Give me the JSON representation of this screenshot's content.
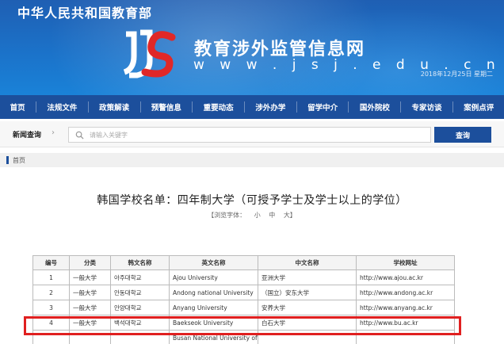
{
  "header": {
    "ministry": "中华人民共和国教育部",
    "site_title": "教育涉外监管信息网",
    "site_url": "w w w . j s j . e d u . c n",
    "date": "2018年12月25日 星期二"
  },
  "nav": {
    "items": [
      {
        "label": "首页"
      },
      {
        "label": "法规文件"
      },
      {
        "label": "政策解读"
      },
      {
        "label": "预警信息"
      },
      {
        "label": "重要动态"
      },
      {
        "label": "涉外办学"
      },
      {
        "label": "留学中介"
      },
      {
        "label": "国外院校"
      },
      {
        "label": "专家访谈"
      },
      {
        "label": "案例点评"
      }
    ]
  },
  "search": {
    "section_label": "新闻查询",
    "placeholder": "请输入关键字",
    "button_label": "查询"
  },
  "breadcrumb": {
    "home": "首页"
  },
  "article": {
    "title": "韩国学校名单：四年制大学（可授予学士及学士以上的学位）",
    "font_label": "【浏览字体：",
    "font_small": "小",
    "font_medium": "中",
    "font_large": "大】"
  },
  "table": {
    "headers": [
      "编号",
      "分类",
      "韩文名称",
      "英文名称",
      "中文名称",
      "学校网址"
    ],
    "rows": [
      [
        "1",
        "一般大学",
        "아주대학교",
        "Ajou University",
        "亚洲大学",
        "http://www.ajou.ac.kr"
      ],
      [
        "2",
        "一般大学",
        "안동대학교",
        "Andong national University",
        "（国立）安东大学",
        "http://www.andong.ac.kr"
      ],
      [
        "3",
        "一般大学",
        "안양대학교",
        "Anyang University",
        "安养大学",
        "http://www.anyang.ac.kr"
      ],
      [
        "4",
        "一般大学",
        "백석대학교",
        "Baekseok University",
        "白石大学",
        "http://www.bu.ac.kr"
      ],
      [
        "",
        "",
        "",
        "Busan National University of",
        "",
        ""
      ]
    ]
  },
  "colors": {
    "nav_bg": "#1c4f9c",
    "highlight": "#e02020"
  }
}
